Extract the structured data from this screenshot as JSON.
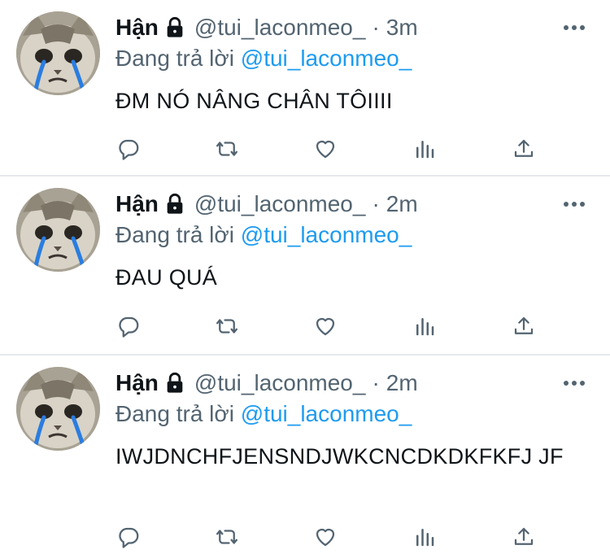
{
  "colors": {
    "text": "#0f1419",
    "muted": "#536471",
    "link": "#1d9bf0",
    "divider": "#e6e9ec"
  },
  "tweets": [
    {
      "author": "Hận",
      "handle": "@tui_laconmeo_",
      "separator": "·",
      "time": "3m",
      "reply_prefix": "Đang trả lời",
      "reply_to": "@tui_laconmeo_",
      "text": "ĐM NÓ NÂNG CHÂN TÔIIII"
    },
    {
      "author": "Hận",
      "handle": "@tui_laconmeo_",
      "separator": "·",
      "time": "2m",
      "reply_prefix": "Đang trả lời",
      "reply_to": "@tui_laconmeo_",
      "text": "ĐAU QUÁ"
    },
    {
      "author": "Hận",
      "handle": "@tui_laconmeo_",
      "separator": "·",
      "time": "2m",
      "reply_prefix": "Đang trả lời",
      "reply_to": "@tui_laconmeo_",
      "text": "IWJDNCHFJENSNDJWKCNCDKDKFKFJ JF"
    }
  ],
  "icons": {
    "lock": "lock-icon",
    "more": "more-icon",
    "reply": "reply-icon",
    "retweet": "retweet-icon",
    "like": "like-icon",
    "views": "views-icon",
    "share": "share-icon"
  }
}
